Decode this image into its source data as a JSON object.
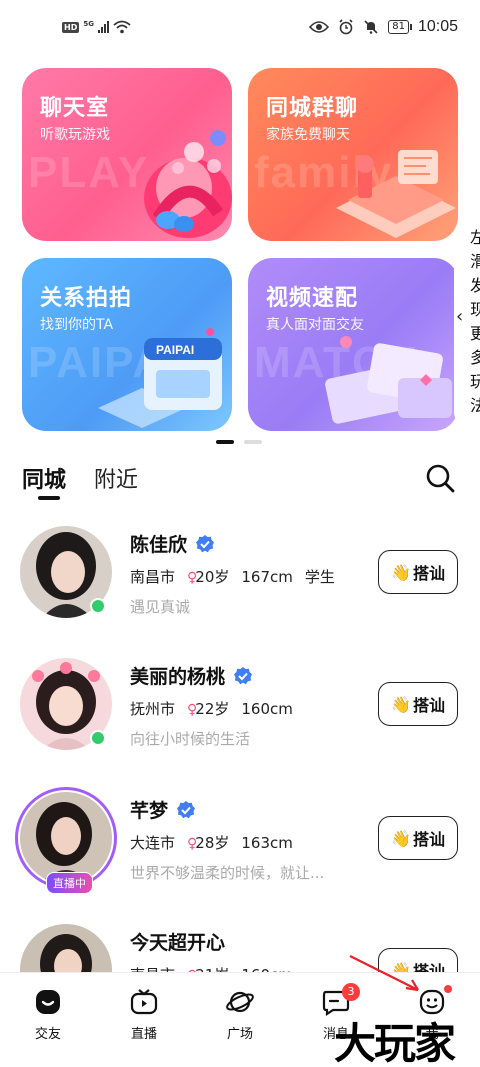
{
  "status_bar": {
    "hd": "HD",
    "network": "5G",
    "battery": "81",
    "time": "10:05"
  },
  "cards": [
    {
      "title": "聊天室",
      "subtitle": "听歌玩游戏",
      "ghost": "PLAY",
      "color": "#ff6694"
    },
    {
      "title": "同城群聊",
      "subtitle": "家族免费聊天",
      "ghost": "family",
      "color": "#ff7a5a"
    },
    {
      "title": "关系拍拍",
      "subtitle": "找到你的TA",
      "ghost": "PAIPAI",
      "art_label": "PAIPAI",
      "color": "#4ea3f8"
    },
    {
      "title": "视频速配",
      "subtitle": "真人面对面交友",
      "ghost": "MATCH",
      "color": "#a07ff6"
    }
  ],
  "side_hint": {
    "text": "左滑发现更多玩法"
  },
  "tabs": [
    {
      "label": "同城",
      "active": true
    },
    {
      "label": "附近",
      "active": false
    }
  ],
  "users": [
    {
      "name": "陈佳欣",
      "verified": true,
      "city": "南昌市",
      "gender": "♀",
      "age": "20岁",
      "height": "167cm",
      "job": "学生",
      "sign": "遇见真诚",
      "status": "online"
    },
    {
      "name": "美丽的杨桃",
      "verified": true,
      "city": "抚州市",
      "gender": "♀",
      "age": "22岁",
      "height": "160cm",
      "job": "",
      "sign": "向往小时候的生活",
      "status": "online"
    },
    {
      "name": "芊梦",
      "verified": true,
      "city": "大连市",
      "gender": "♀",
      "age": "28岁",
      "height": "163cm",
      "job": "",
      "sign": "世界不够温柔的时候，就让...",
      "status": "live",
      "live_label": "直播中"
    },
    {
      "name": "今天超开心",
      "verified": false,
      "city": "南昌市",
      "gender": "♀",
      "age": "21岁",
      "height": "160cm",
      "job": "",
      "sign": "",
      "status": ""
    }
  ],
  "greet_label": "搭讪",
  "nav": [
    {
      "label": "交友",
      "icon": "friends-icon",
      "active": true
    },
    {
      "label": "直播",
      "icon": "tv-icon"
    },
    {
      "label": "广场",
      "icon": "planet-icon"
    },
    {
      "label": "消息",
      "icon": "message-icon",
      "badge": "3"
    },
    {
      "label": "我",
      "icon": "profile-icon",
      "dot": true
    }
  ],
  "watermark": "大玩家"
}
